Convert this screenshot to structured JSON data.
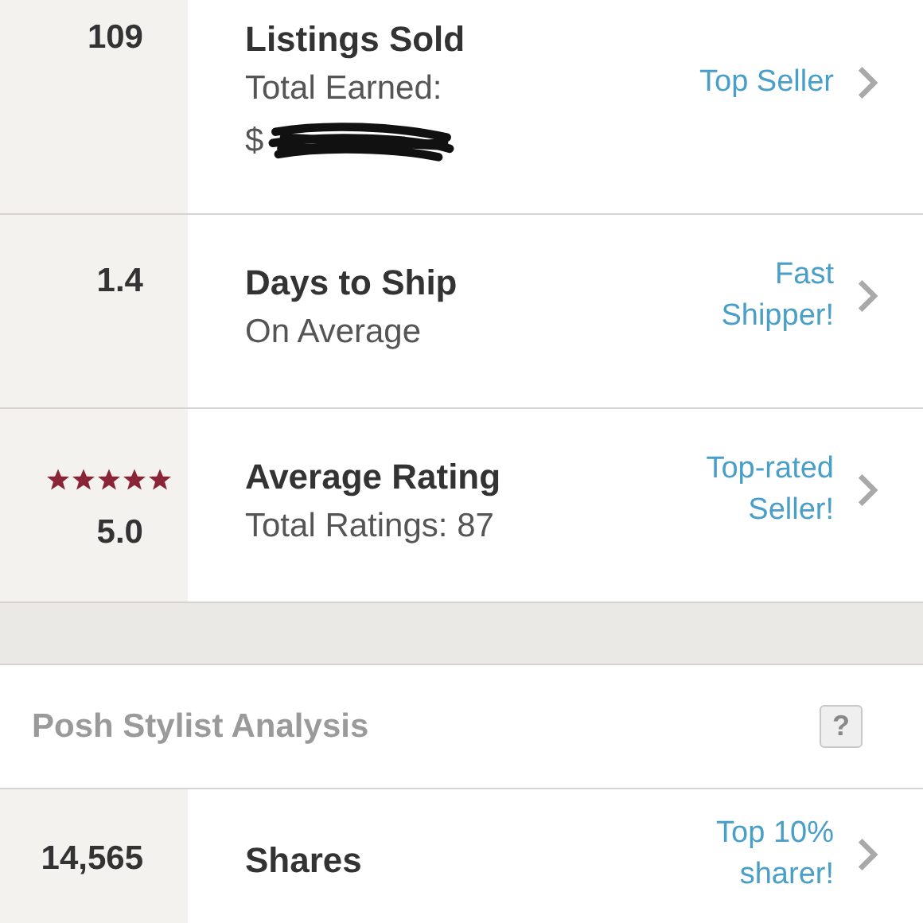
{
  "stats": [
    {
      "value": "109",
      "title": "Listings Sold",
      "subtitle": "Total Earned:",
      "redacted_prefix": "$",
      "badge": "Top Seller"
    },
    {
      "value": "1.4",
      "title": "Days to Ship",
      "subtitle": "On Average",
      "badge": "Fast Shipper!"
    },
    {
      "value": "5.0",
      "stars": 5,
      "title": "Average Rating",
      "subtitle": "Total Ratings: 87",
      "badge": "Top-rated Seller!"
    }
  ],
  "section": {
    "title": "Posh Stylist Analysis",
    "help": "?"
  },
  "analysis": [
    {
      "value": "14,565",
      "title": "Shares",
      "badge": "Top 10% sharer!"
    }
  ]
}
